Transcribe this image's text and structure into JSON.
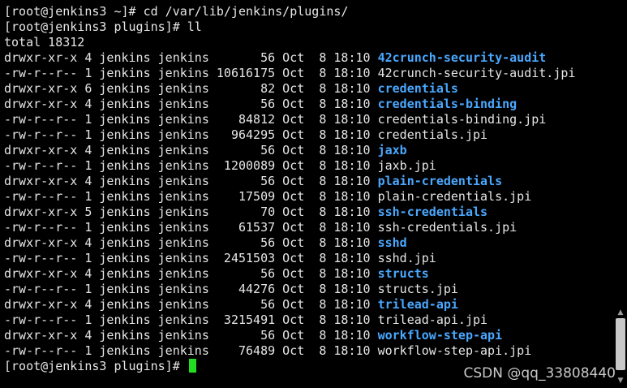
{
  "prompts": {
    "line1": "[root@jenkins3 ~]# cd /var/lib/jenkins/plugins/",
    "line2": "[root@jenkins3 plugins]# ll",
    "total": "total 18312",
    "final": "[root@jenkins3 plugins]# "
  },
  "listing": [
    {
      "meta": "drwxr-xr-x 4 jenkins jenkins       56 Oct  8 18:10 ",
      "name": "42crunch-security-audit",
      "is_dir": true
    },
    {
      "meta": "-rw-r--r-- 1 jenkins jenkins 10616175 Oct  8 18:10 ",
      "name": "42crunch-security-audit.jpi",
      "is_dir": false
    },
    {
      "meta": "drwxr-xr-x 6 jenkins jenkins       82 Oct  8 18:10 ",
      "name": "credentials",
      "is_dir": true
    },
    {
      "meta": "drwxr-xr-x 4 jenkins jenkins       56 Oct  8 18:10 ",
      "name": "credentials-binding",
      "is_dir": true
    },
    {
      "meta": "-rw-r--r-- 1 jenkins jenkins    84812 Oct  8 18:10 ",
      "name": "credentials-binding.jpi",
      "is_dir": false
    },
    {
      "meta": "-rw-r--r-- 1 jenkins jenkins   964295 Oct  8 18:10 ",
      "name": "credentials.jpi",
      "is_dir": false
    },
    {
      "meta": "drwxr-xr-x 4 jenkins jenkins       56 Oct  8 18:10 ",
      "name": "jaxb",
      "is_dir": true
    },
    {
      "meta": "-rw-r--r-- 1 jenkins jenkins  1200089 Oct  8 18:10 ",
      "name": "jaxb.jpi",
      "is_dir": false
    },
    {
      "meta": "drwxr-xr-x 4 jenkins jenkins       56 Oct  8 18:10 ",
      "name": "plain-credentials",
      "is_dir": true
    },
    {
      "meta": "-rw-r--r-- 1 jenkins jenkins    17509 Oct  8 18:10 ",
      "name": "plain-credentials.jpi",
      "is_dir": false
    },
    {
      "meta": "drwxr-xr-x 5 jenkins jenkins       70 Oct  8 18:10 ",
      "name": "ssh-credentials",
      "is_dir": true
    },
    {
      "meta": "-rw-r--r-- 1 jenkins jenkins    61537 Oct  8 18:10 ",
      "name": "ssh-credentials.jpi",
      "is_dir": false
    },
    {
      "meta": "drwxr-xr-x 4 jenkins jenkins       56 Oct  8 18:10 ",
      "name": "sshd",
      "is_dir": true
    },
    {
      "meta": "-rw-r--r-- 1 jenkins jenkins  2451503 Oct  8 18:10 ",
      "name": "sshd.jpi",
      "is_dir": false
    },
    {
      "meta": "drwxr-xr-x 4 jenkins jenkins       56 Oct  8 18:10 ",
      "name": "structs",
      "is_dir": true
    },
    {
      "meta": "-rw-r--r-- 1 jenkins jenkins    44276 Oct  8 18:10 ",
      "name": "structs.jpi",
      "is_dir": false
    },
    {
      "meta": "drwxr-xr-x 4 jenkins jenkins       56 Oct  8 18:10 ",
      "name": "trilead-api",
      "is_dir": true
    },
    {
      "meta": "-rw-r--r-- 1 jenkins jenkins  3215491 Oct  8 18:10 ",
      "name": "trilead-api.jpi",
      "is_dir": false
    },
    {
      "meta": "drwxr-xr-x 4 jenkins jenkins       56 Oct  8 18:10 ",
      "name": "workflow-step-api",
      "is_dir": true
    },
    {
      "meta": "-rw-r--r-- 1 jenkins jenkins    76489 Oct  8 18:10 ",
      "name": "workflow-step-api.jpi",
      "is_dir": false
    }
  ],
  "watermark": "CSDN @qq_33808440",
  "colors": {
    "background": "#000000",
    "text": "#e6e6e6",
    "directory": "#4aa8ff",
    "cursor": "#22dd22"
  },
  "icons": {
    "scroll_up": "chevron-up-icon",
    "scroll_down": "chevron-down-icon"
  }
}
